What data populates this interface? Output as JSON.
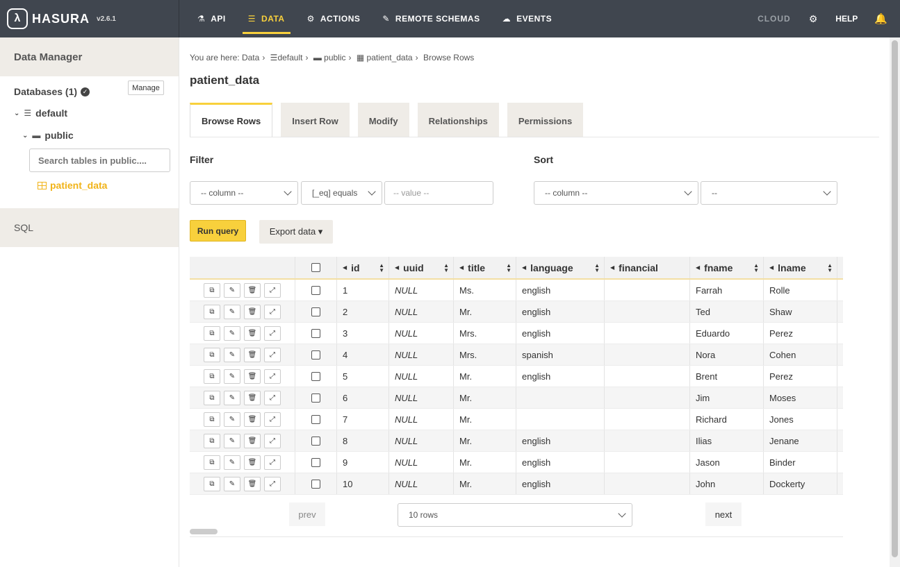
{
  "brand": {
    "logo": "λ",
    "name": "HASURA",
    "version": "v2.6.1"
  },
  "nav": [
    {
      "label": "API",
      "icon": "flask-icon",
      "glyph": "⚗"
    },
    {
      "label": "DATA",
      "icon": "database-icon",
      "glyph": "☰",
      "active": true
    },
    {
      "label": "ACTIONS",
      "icon": "cogs-icon",
      "glyph": "⚙"
    },
    {
      "label": "REMOTE SCHEMAS",
      "icon": "plug-icon",
      "glyph": "✎"
    },
    {
      "label": "EVENTS",
      "icon": "cloud-icon",
      "glyph": "☁"
    }
  ],
  "nav_right": {
    "cloud": "CLOUD",
    "gear": "⚙",
    "help": "HELP",
    "bell": "🔔"
  },
  "sidebar": {
    "header": "Data Manager",
    "databases_label": "Databases (1)",
    "manage": "Manage",
    "database": "default",
    "schema": "public",
    "search_placeholder": "Search tables in public....",
    "table": "patient_data",
    "sql": "SQL"
  },
  "breadcrumb": {
    "prefix": "You are here:",
    "items": [
      "Data",
      "default",
      "public",
      "patient_data",
      "Browse Rows"
    ]
  },
  "page_title": "patient_data",
  "tabs": [
    "Browse Rows",
    "Insert Row",
    "Modify",
    "Relationships",
    "Permissions"
  ],
  "filter": {
    "label": "Filter",
    "column": "-- column --",
    "operator": "[_eq] equals",
    "value_placeholder": "-- value --"
  },
  "sort": {
    "label": "Sort",
    "column": "-- column --",
    "order": "--"
  },
  "buttons": {
    "run_query": "Run query",
    "export": "Export data ▾"
  },
  "table": {
    "columns": [
      "id",
      "uuid",
      "title",
      "language",
      "financial",
      "fname",
      "lname"
    ],
    "rows": [
      [
        "1",
        "NULL",
        "Ms.",
        "english",
        "",
        "Farrah",
        "Rolle"
      ],
      [
        "2",
        "NULL",
        "Mr.",
        "english",
        "",
        "Ted",
        "Shaw"
      ],
      [
        "3",
        "NULL",
        "Mrs.",
        "english",
        "",
        "Eduardo",
        "Perez"
      ],
      [
        "4",
        "NULL",
        "Mrs.",
        "spanish",
        "",
        "Nora",
        "Cohen"
      ],
      [
        "5",
        "NULL",
        "Mr.",
        "english",
        "",
        "Brent",
        "Perez"
      ],
      [
        "6",
        "NULL",
        "Mr.",
        "",
        "",
        "Jim",
        "Moses"
      ],
      [
        "7",
        "NULL",
        "Mr.",
        "",
        "",
        "Richard",
        "Jones"
      ],
      [
        "8",
        "NULL",
        "Mr.",
        "english",
        "",
        "Ilias",
        "Jenane"
      ],
      [
        "9",
        "NULL",
        "Mr.",
        "english",
        "",
        "Jason",
        "Binder"
      ],
      [
        "10",
        "NULL",
        "Mr.",
        "english",
        "",
        "John",
        "Dockerty"
      ]
    ]
  },
  "pagination": {
    "prev": "prev",
    "rows": "10 rows",
    "next": "next"
  },
  "colors": {
    "topbar": "#40464f",
    "accent": "#f8d03c",
    "sidebar_header": "#efece7"
  }
}
